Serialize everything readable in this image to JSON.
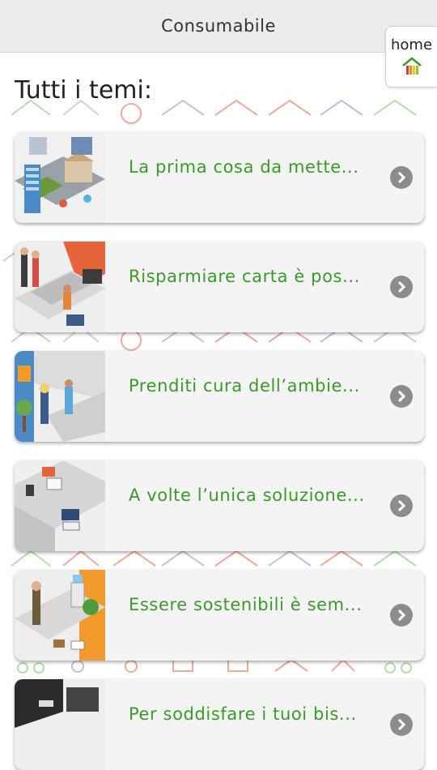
{
  "header": {
    "title": "Consumabile"
  },
  "home": {
    "label": "home",
    "icon": "home-icon"
  },
  "section": {
    "title": "Tutti i temi:"
  },
  "themes": [
    {
      "label": "La prima cosa da mette...",
      "image": "city-buildings-illustration"
    },
    {
      "label": "Risparmiare carta è pos...",
      "image": "office-printer-illustration"
    },
    {
      "label": "Prenditi cura dell’ambie...",
      "image": "office-people-illustration"
    },
    {
      "label": "A volte l’unica soluzione...",
      "image": "office-desk-illustration"
    },
    {
      "label": "Essere sostenibili è sem...",
      "image": "office-water-cooler-illustration"
    },
    {
      "label": "Per soddisfare i tuoi bis...",
      "image": "office-dark-illustration"
    }
  ],
  "colors": {
    "label_green": "#3a9a29",
    "topbar": "#ececec",
    "chevron": "#8c8c8c"
  }
}
